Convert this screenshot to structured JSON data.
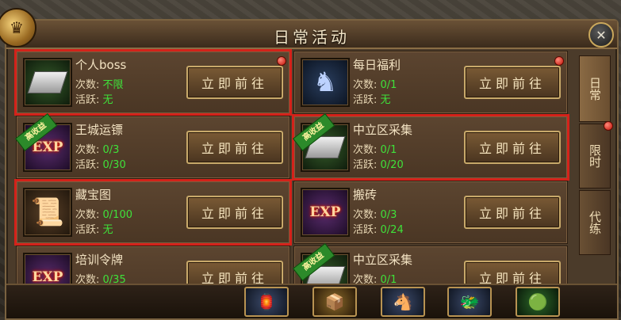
{
  "window": {
    "title": "日常活动"
  },
  "tabs": [
    {
      "label": "日常"
    },
    {
      "label": "限时"
    },
    {
      "label": "代练"
    }
  ],
  "labels": {
    "count": "次数:",
    "activity": "活跃:"
  },
  "button_label": "立即前往",
  "badge_label": "高收益",
  "cards": [
    {
      "name": "个人boss",
      "count": "不限",
      "activity": "无",
      "icon": "silver-ingot-icon"
    },
    {
      "name": "每日福利",
      "count": "0/1",
      "activity": "无",
      "icon": "beast-mount-icon"
    },
    {
      "name": "王城运镖",
      "count": "0/3",
      "activity": "0/30",
      "icon": "exp-icon"
    },
    {
      "name": "中立区采集",
      "count": "0/1",
      "activity": "0/20",
      "icon": "silver-ingot-icon"
    },
    {
      "name": "藏宝图",
      "count": "0/100",
      "activity": "无",
      "icon": "treasure-map-icon"
    },
    {
      "name": "搬砖",
      "count": "0/3",
      "activity": "0/24",
      "icon": "exp-icon"
    },
    {
      "name": "培训令牌",
      "count": "0/35",
      "activity": "",
      "icon": "exp-icon"
    },
    {
      "name": "中立区采集",
      "count": "0/1",
      "activity": "",
      "icon": "silver-ingot-icon"
    }
  ],
  "colors": {
    "highlight": "#d4221a",
    "value_green": "#3fe13a"
  }
}
